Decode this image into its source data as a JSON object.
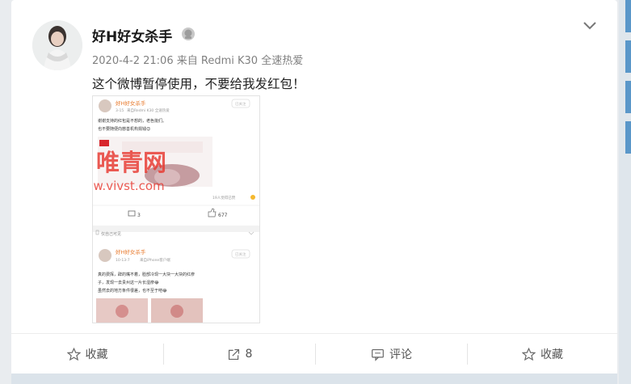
{
  "post": {
    "username": "好H好女杀手",
    "date": "2020-4-2 21:06",
    "source_prefix": "来自",
    "source_device": "Redmi K30",
    "source_suffix": "全速热爱",
    "text": "这个微博暂停使用，不要给我发红包！"
  },
  "screenshot": {
    "top_post": {
      "username": "好H好女杀手",
      "date": "3-15",
      "device": "来自Redmi K30 全速热爱",
      "follow": "已关注",
      "body_line1": "谢谢支持的红包是不想的，老色批们。",
      "body_line2": "也不要随便向慈善机构捐钱😊",
      "likes_note": "19人觉得已赞",
      "comments": "3",
      "likes": "677"
    },
    "watermark_cn": "唯青网",
    "watermark_url": "www.vivst.com",
    "visibility": "仅自己可见",
    "second_post": {
      "username": "好H好女杀手",
      "date": "10-13-7",
      "device": "来自iPhone客户端",
      "follow": "已关注",
      "body_line1": "真的费挥，辟的嘴不着，脸部冷现一大块一大块的红疹",
      "body_line2": "子，发现一去贵州这一片长湿疹😂",
      "body_line3": "虽然去的地方条件很差，也不至于吧😂"
    }
  },
  "actions": {
    "favorite_label": "收藏",
    "repost_count": "8",
    "comment_label": "评论",
    "like_label": "收藏"
  },
  "colors": {
    "watermark": "#e8382f",
    "accent_blue": "#5a97c9"
  }
}
